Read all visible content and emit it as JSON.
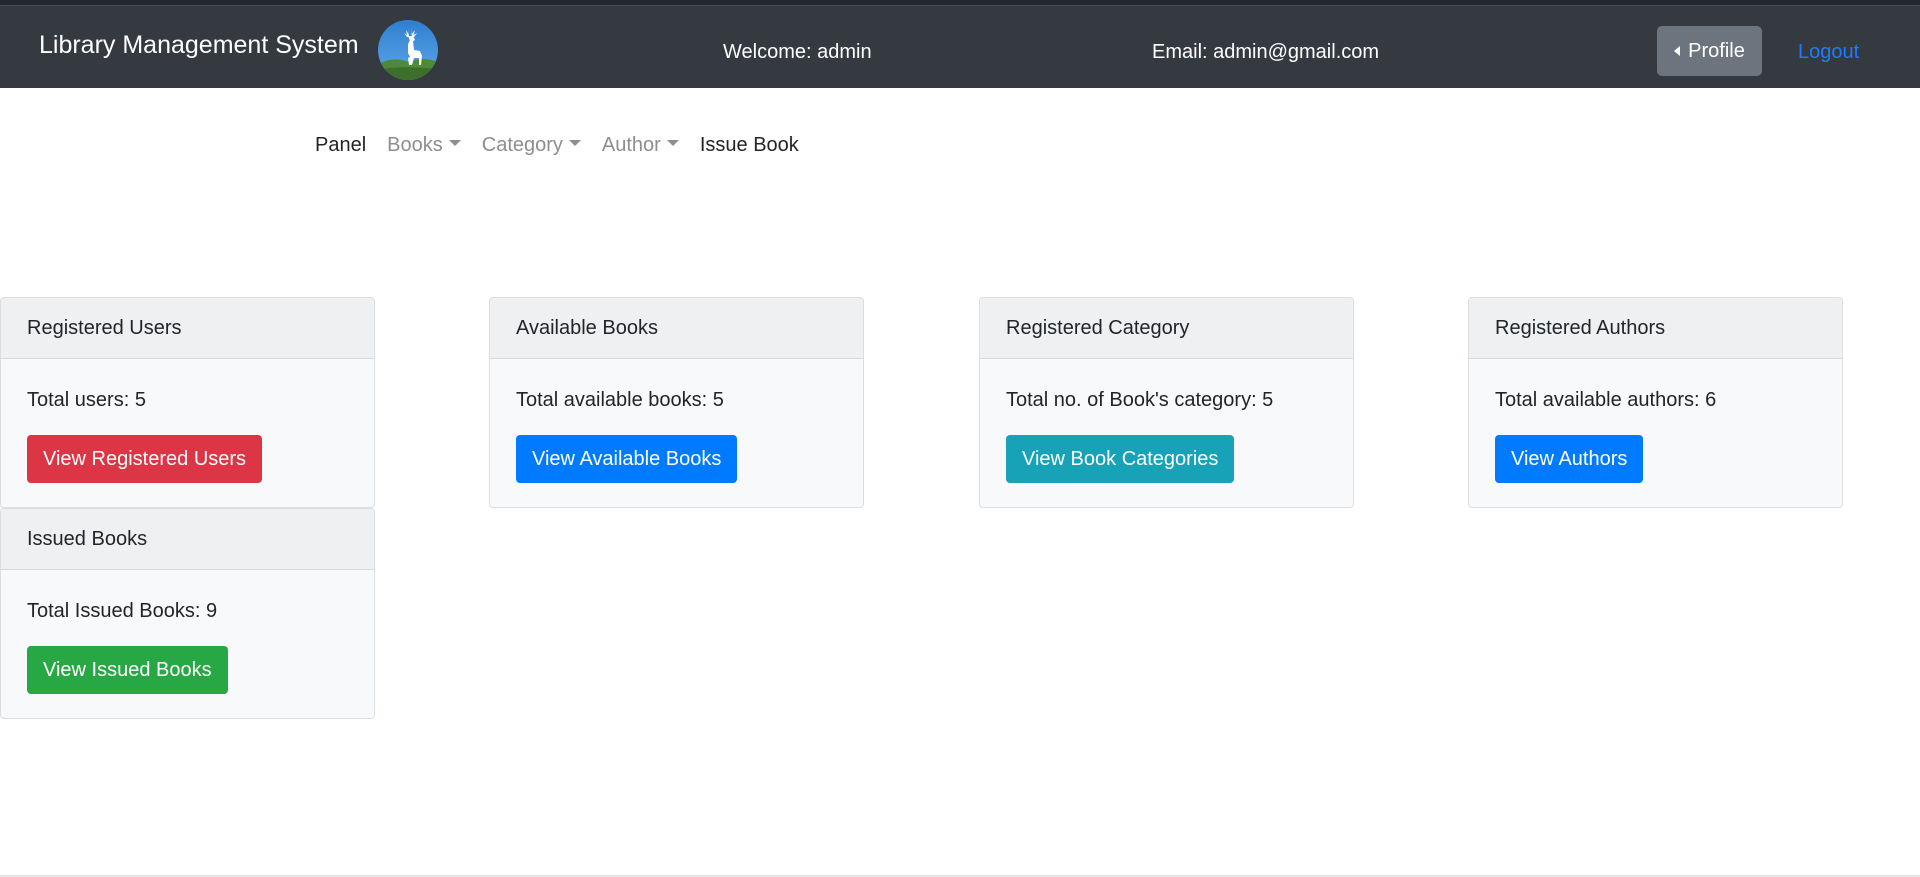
{
  "header": {
    "brand": "Library Management System",
    "logo_icon": "deer-logo-icon",
    "welcome": "Welcome: admin",
    "email": "Email: admin@gmail.com",
    "profile_label": "Profile",
    "logout_label": "Logout",
    "colors": {
      "background": "#343a40",
      "profile_button": "#6c757d",
      "logout_link": "#1d7bff"
    }
  },
  "nav": {
    "panel": "Panel",
    "books": "Books",
    "category": "Category",
    "author": "Author",
    "issue_book": "Issue Book"
  },
  "cards": {
    "users": {
      "title": "Registered Users",
      "text": "Total users: 5",
      "button": "View Registered Users",
      "color": "#dc3545"
    },
    "books": {
      "title": "Available Books",
      "text": "Total available books: 5",
      "button": "View Available Books",
      "color": "#007bff"
    },
    "category": {
      "title": "Registered Category",
      "text": "Total no. of Book's category: 5",
      "button": "View Book Categories",
      "color": "#17a2b8"
    },
    "authors": {
      "title": "Registered Authors",
      "text": "Total available authors: 6",
      "button": "View Authors",
      "color": "#007bff"
    },
    "issued": {
      "title": "Issued Books",
      "text": "Total Issued Books: 9",
      "button": "View Issued Books",
      "color": "#28a745"
    }
  }
}
